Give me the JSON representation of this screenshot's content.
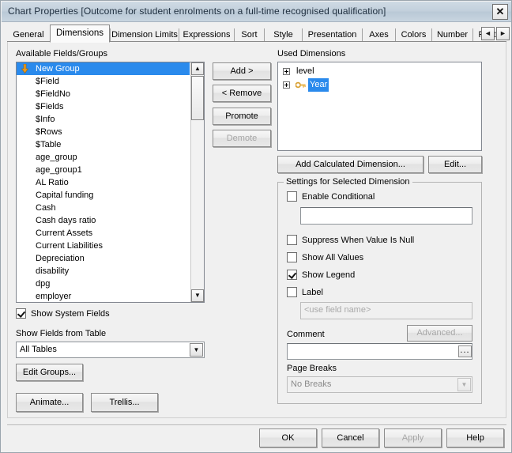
{
  "window": {
    "title": "Chart Properties [Outcome for student enrolments on a full-time recognised qualification]",
    "close_label": "✕"
  },
  "tabs": {
    "items": [
      {
        "label": "General",
        "active": false
      },
      {
        "label": "Dimensions",
        "active": true
      },
      {
        "label": "Dimension Limits",
        "active": false
      },
      {
        "label": "Expressions",
        "active": false
      },
      {
        "label": "Sort",
        "active": false
      },
      {
        "label": "Style",
        "active": false
      },
      {
        "label": "Presentation",
        "active": false
      },
      {
        "label": "Axes",
        "active": false
      },
      {
        "label": "Colors",
        "active": false
      },
      {
        "label": "Number",
        "active": false
      },
      {
        "label": "Font",
        "active": false
      }
    ],
    "scroll_left": "◄",
    "scroll_right": "►"
  },
  "available_fields": {
    "caption": "Available Fields/Groups",
    "items": [
      {
        "label": "New Group",
        "selected": true,
        "icon": "new-group-arrow-icon"
      },
      {
        "label": "$Field",
        "selected": false
      },
      {
        "label": "$FieldNo",
        "selected": false
      },
      {
        "label": "$Fields",
        "selected": false
      },
      {
        "label": "$Info",
        "selected": false
      },
      {
        "label": "$Rows",
        "selected": false
      },
      {
        "label": "$Table",
        "selected": false
      },
      {
        "label": "age_group",
        "selected": false
      },
      {
        "label": "age_group1",
        "selected": false
      },
      {
        "label": "AL Ratio",
        "selected": false
      },
      {
        "label": "Capital funding",
        "selected": false
      },
      {
        "label": "Cash",
        "selected": false
      },
      {
        "label": "Cash days ratio",
        "selected": false
      },
      {
        "label": "Current Assets",
        "selected": false
      },
      {
        "label": "Current Liabilities",
        "selected": false
      },
      {
        "label": "Depreciation",
        "selected": false
      },
      {
        "label": "disability",
        "selected": false
      },
      {
        "label": "dpg",
        "selected": false
      },
      {
        "label": "employer",
        "selected": false
      }
    ],
    "scroll_up": "▲",
    "scroll_down": "▼"
  },
  "transfer_buttons": {
    "add": "Add >",
    "remove": "< Remove",
    "promote": "Promote",
    "demote": "Demote"
  },
  "used_dimensions": {
    "caption": "Used Dimensions",
    "items": [
      {
        "label": "level",
        "selected": false,
        "has_key_icon": false
      },
      {
        "label": "Year",
        "selected": true,
        "has_key_icon": true
      }
    ],
    "add_calculated": "Add Calculated Dimension...",
    "edit": "Edit..."
  },
  "settings": {
    "title": "Settings for Selected Dimension",
    "enable_conditional": {
      "label": "Enable Conditional",
      "checked": false
    },
    "conditional_expression": {
      "value": ""
    },
    "suppress_when_null": {
      "label": "Suppress When Value Is Null",
      "checked": false
    },
    "show_all_values": {
      "label": "Show All Values",
      "checked": false
    },
    "show_legend": {
      "label": "Show Legend",
      "checked": true
    },
    "label_checkbox": {
      "label": "Label",
      "checked": false
    },
    "label_field": {
      "placeholder": "<use field name>",
      "value": ""
    },
    "advanced_button": "Advanced...",
    "comment_caption": "Comment",
    "comment_field": {
      "value": ""
    },
    "comment_browse": "...",
    "page_breaks_caption": "Page Breaks",
    "page_breaks_value": "No Breaks"
  },
  "left_bottom": {
    "show_system_fields": {
      "label": "Show System Fields",
      "checked": true
    },
    "show_fields_caption": "Show Fields from Table",
    "table_selector_value": "All Tables",
    "edit_groups": "Edit Groups...",
    "animate": "Animate...",
    "trellis": "Trellis..."
  },
  "footer": {
    "ok": "OK",
    "cancel": "Cancel",
    "apply": "Apply",
    "help": "Help"
  },
  "colors": {
    "selection_blue": "#2a8aec",
    "titlebar": "#c3d0dc",
    "dialog_bg": "#f0f0f0",
    "key_icon_gold": "#e0a92e"
  }
}
